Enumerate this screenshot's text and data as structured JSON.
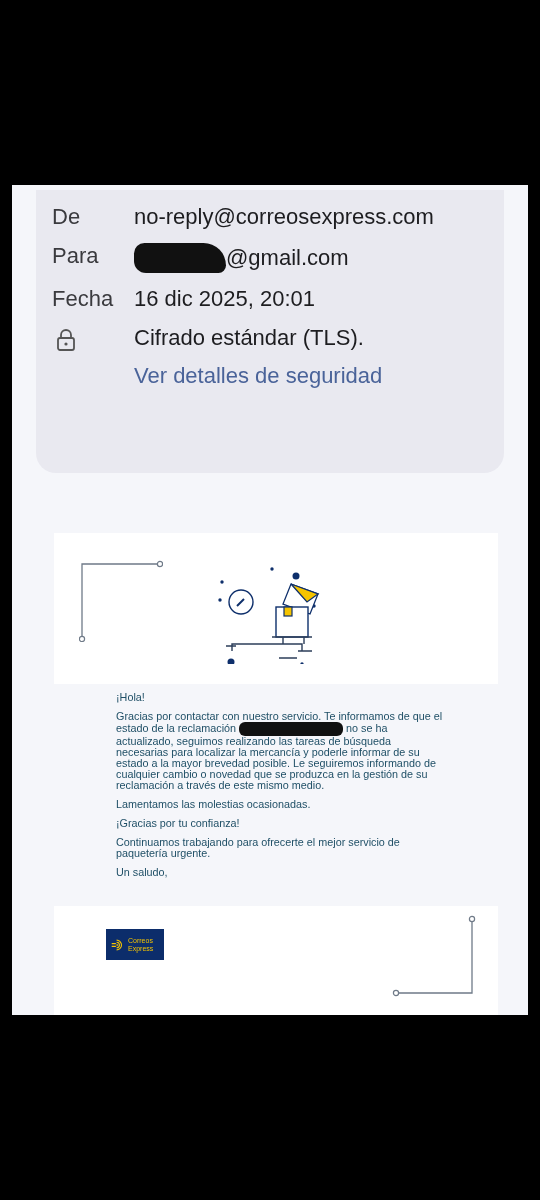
{
  "header": {
    "rows": [
      {
        "label": "De",
        "value": "no-reply@correosexpress.com",
        "redacted": false
      },
      {
        "label": "Para",
        "value": "@gmail.com",
        "redacted": true
      },
      {
        "label": "Fecha",
        "value": "16 dic 2025, 20:01",
        "redacted": false
      }
    ],
    "security": {
      "text": "Cifrado estándar (TLS).",
      "link": "Ver detalles de seguridad"
    }
  },
  "body": {
    "greeting": "¡Hola!",
    "paragraph_before": "Gracias por contactar con nuestro servicio. Te informamos de que el estado de la reclamación",
    "paragraph_redacted": true,
    "paragraph_after": "no se ha actualizado, seguimos realizando las tareas de búsqueda necesarias para localizar la mercancía y poderle informar de su estado a la mayor brevedad posible. Le seguiremos informando de cualquier cambio o novedad que se produzca en la gestión de su reclamación a través de este mismo medio.",
    "lines": [
      "Lamentamos las molestias ocasionadas.",
      "¡Gracias por tu confianza!",
      "Continuamos trabajando para ofrecerte el mejor servicio de paquetería urgente.",
      "Un saludo,"
    ]
  },
  "logo": {
    "line1": "Correos",
    "line2": "Express"
  }
}
